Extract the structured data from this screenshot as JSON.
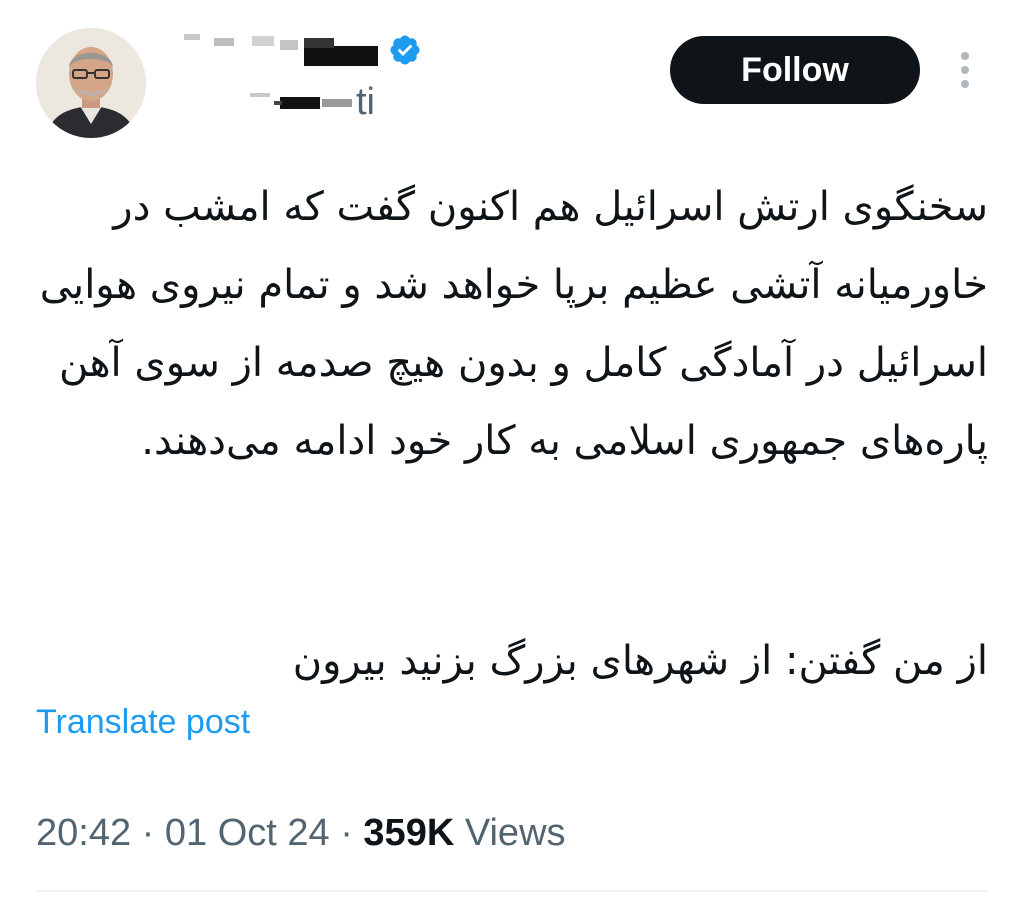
{
  "author": {
    "handle_suffix": "ti",
    "verified": true
  },
  "follow_button": {
    "label": "Follow"
  },
  "tweet": {
    "paragraph_1": "سخنگوی ارتش اسرائیل هم اکنون گفت که امشب در خاورمیانه آتشی عظیم برپا خواهد شد و تمام نیروی هوایی اسرائیل در آمادگی کامل و بدون هیچ صدمه از سوی آهن پاره‌های جمهوری اسلامی به کار خود ادامه می‌دهند.",
    "paragraph_2": "از من گفتن: از شهرهای بزرگ بزنید بیرون"
  },
  "translate_link": "Translate post",
  "meta": {
    "time": "20:42",
    "separator": "·",
    "date": "01 Oct 24",
    "views_count": "359K",
    "views_label": "Views"
  },
  "colors": {
    "text": "#0f1419",
    "secondary": "#536471",
    "link": "#1d9bf0",
    "verified": "#1d9bf0",
    "follow_bg": "#0f1419"
  },
  "icons": {
    "verified": "verified-badge-icon",
    "more": "more-vertical-icon"
  }
}
